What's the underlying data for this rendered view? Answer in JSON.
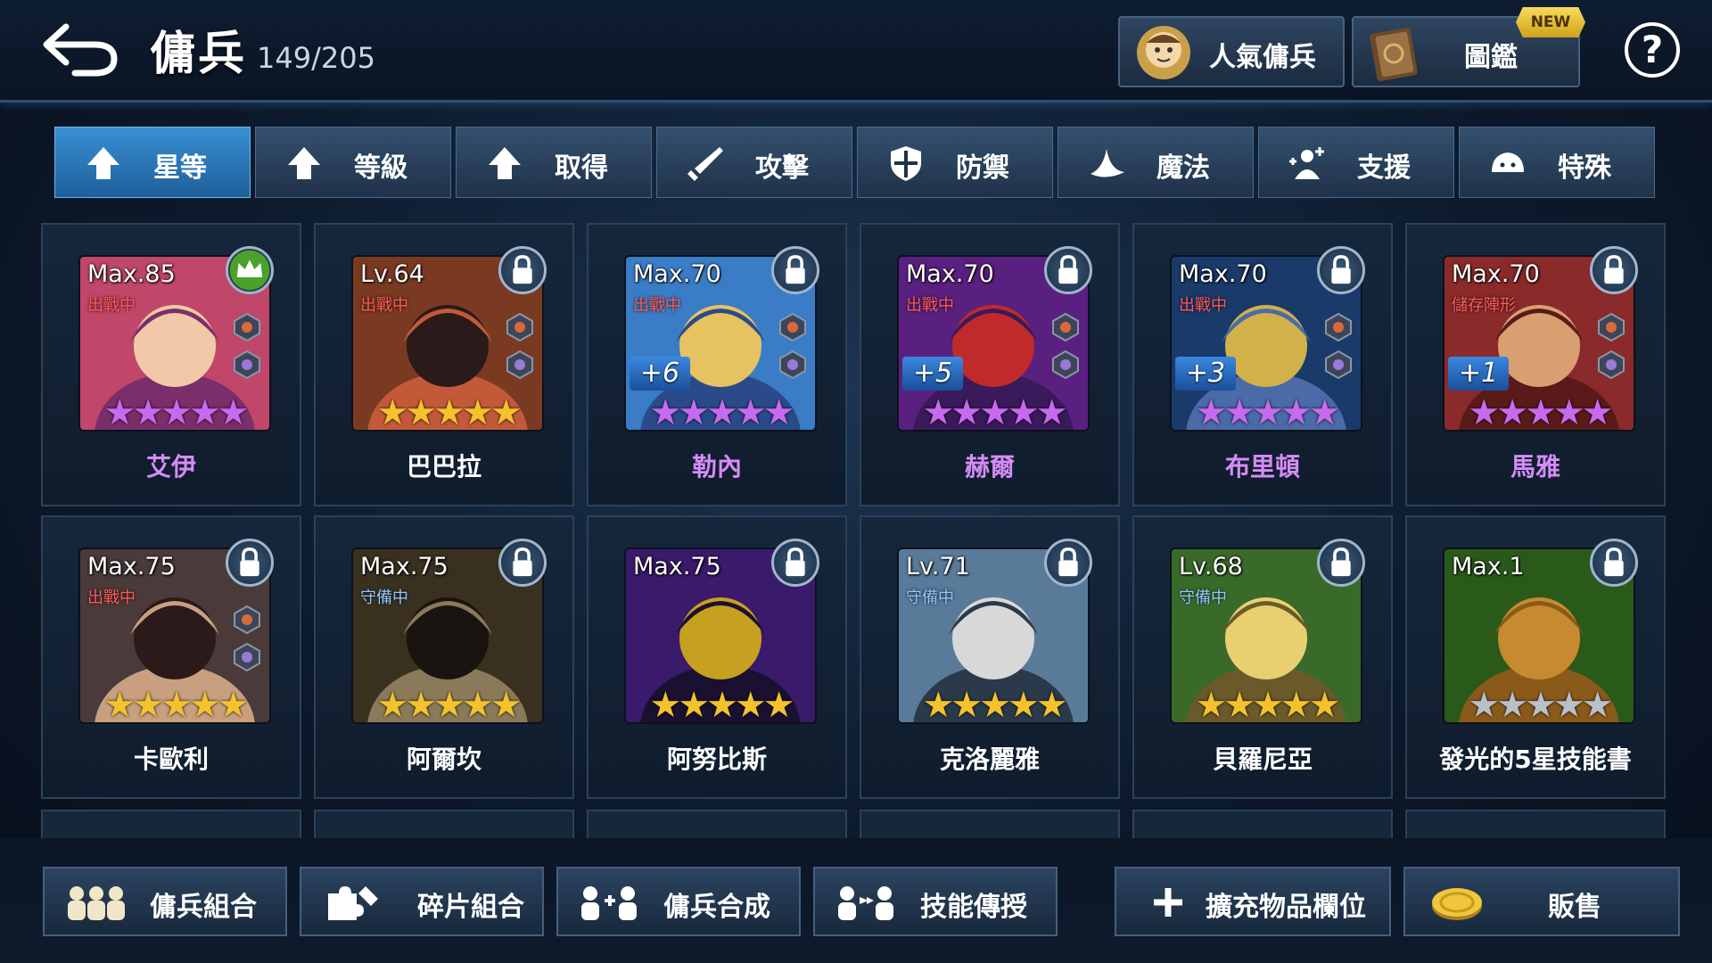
{
  "header": {
    "title": "傭兵",
    "count": "149/205",
    "popular_label": "人氣傭兵",
    "codex_label": "圖鑑",
    "new_badge": "NEW",
    "help_label": "?"
  },
  "tabs": [
    {
      "label": "星等",
      "icon": "up-arrow-icon",
      "active": true
    },
    {
      "label": "等級",
      "icon": "up-arrow-icon",
      "active": false
    },
    {
      "label": "取得",
      "icon": "up-arrow-icon",
      "active": false
    },
    {
      "label": "攻擊",
      "icon": "sword-icon",
      "active": false
    },
    {
      "label": "防禦",
      "icon": "shield-icon",
      "active": false
    },
    {
      "label": "魔法",
      "icon": "magic-hat-icon",
      "active": false
    },
    {
      "label": "支援",
      "icon": "support-icon",
      "active": false
    },
    {
      "label": "特殊",
      "icon": "special-icon",
      "active": false
    }
  ],
  "cards": [
    {
      "name": "艾伊",
      "level": "Max.85",
      "status": "出戰中",
      "plus": "",
      "stars": "★★★★★",
      "star_color": "purple",
      "corner": "crown-icon",
      "name_color": "purple"
    },
    {
      "name": "巴巴拉",
      "level": "Lv.64",
      "status": "出戰中",
      "plus": "",
      "stars": "★★★★★",
      "star_color": "gold",
      "corner": "lock-icon",
      "name_color": "white"
    },
    {
      "name": "勒內",
      "level": "Max.70",
      "status": "出戰中",
      "plus": "+6",
      "stars": "★★★★★",
      "star_color": "purple",
      "corner": "lock-icon",
      "name_color": "purple"
    },
    {
      "name": "赫爾",
      "level": "Max.70",
      "status": "出戰中",
      "plus": "+5",
      "stars": "★★★★★",
      "star_color": "purple",
      "corner": "lock-icon",
      "name_color": "purple"
    },
    {
      "name": "布里頓",
      "level": "Max.70",
      "status": "出戰中",
      "plus": "+3",
      "stars": "★★★★★",
      "star_color": "purple",
      "corner": "lock-icon",
      "name_color": "purple"
    },
    {
      "name": "馬雅",
      "level": "Max.70",
      "status": "儲存陣形",
      "plus": "+1",
      "stars": "★★★★★",
      "star_color": "purple",
      "corner": "lock-icon",
      "name_color": "purple"
    },
    {
      "name": "卡歐利",
      "level": "Max.75",
      "status": "出戰中",
      "plus": "",
      "stars": "★★★★★",
      "star_color": "gold",
      "corner": "lock-icon",
      "name_color": "white"
    },
    {
      "name": "阿爾坎",
      "level": "Max.75",
      "status": "守備中",
      "plus": "",
      "stars": "★★★★★",
      "star_color": "gold",
      "corner": "lock-icon",
      "name_color": "white"
    },
    {
      "name": "阿努比斯",
      "level": "Max.75",
      "status": "",
      "plus": "",
      "stars": "★★★★★",
      "star_color": "gold",
      "corner": "lock-icon",
      "name_color": "white"
    },
    {
      "name": "克洛麗雅",
      "level": "Lv.71",
      "status": "守備中",
      "plus": "",
      "stars": "★★★★★",
      "star_color": "gold",
      "corner": "lock-icon",
      "name_color": "white"
    },
    {
      "name": "貝羅尼亞",
      "level": "Lv.68",
      "status": "守備中",
      "plus": "",
      "stars": "★★★★★",
      "star_color": "gold",
      "corner": "lock-icon",
      "name_color": "white"
    },
    {
      "name": "發光的5星技能書",
      "level": "Max.1",
      "status": "",
      "plus": "",
      "stars": "★★★★★",
      "star_color": "silver",
      "corner": "lock-icon",
      "name_color": "white"
    }
  ],
  "bottom": [
    {
      "label": "傭兵組合",
      "icon": "mercenary-group-icon"
    },
    {
      "label": "碎片組合",
      "icon": "puzzle-pieces-icon"
    },
    {
      "label": "傭兵合成",
      "icon": "merge-mercenary-icon"
    },
    {
      "label": "技能傳授",
      "icon": "skill-transfer-icon"
    },
    {
      "label": "擴充物品欄位",
      "icon": "plus-icon"
    },
    {
      "label": "販售",
      "icon": "gold-coin-icon"
    }
  ],
  "colors": {
    "accent_tab": "#2f7fc2",
    "purple_star": "#c86af0",
    "gold_star": "#f4c22c",
    "status_red": "#ff5a5a"
  }
}
